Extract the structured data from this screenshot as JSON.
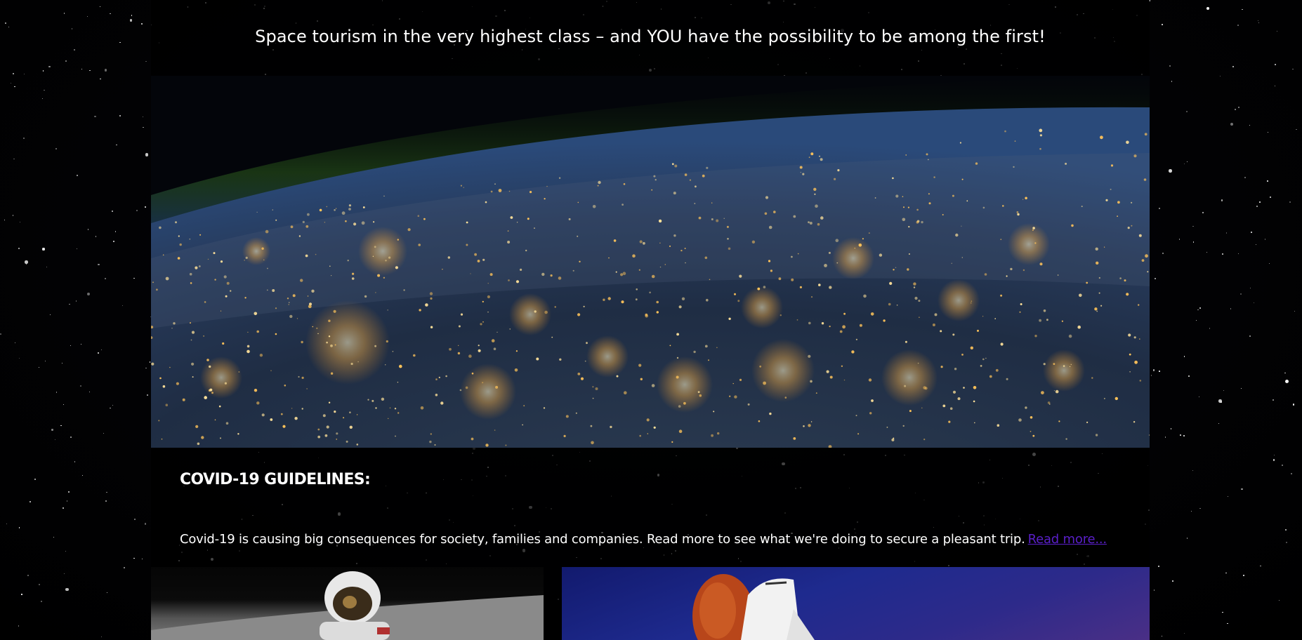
{
  "page": {
    "tagline": "Space tourism in the very highest class – and YOU have the possibility to be among the first!"
  },
  "hero": {
    "image_alt": "earth-at-night-from-orbit-image"
  },
  "covid": {
    "heading": "COVID-19 GUIDELINES:",
    "body": "Covid-19 is causing big consequences for society, families and companies. Read more to see what we're doing to secure a pleasant trip.",
    "read_more_label": "Read more..."
  },
  "gallery": {
    "items": [
      {
        "label": "astronaut-on-moon-image"
      },
      {
        "label": "space-shuttle-launch-image"
      }
    ]
  },
  "colors": {
    "background": "#000000",
    "text": "#ffffff",
    "link": "#5a1fc9"
  }
}
